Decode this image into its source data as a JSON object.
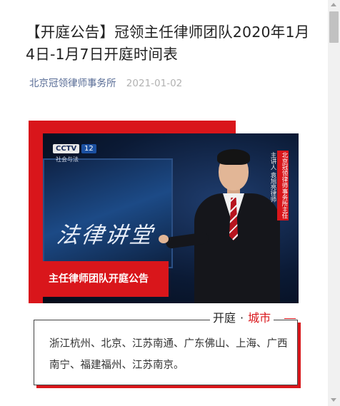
{
  "article": {
    "title": "【开庭公告】冠领主任律师团队2020年1月4日-1月7日开庭时间表",
    "author": "北京冠领律师事务所",
    "date": "2021-01-02"
  },
  "cover": {
    "tv_logo": "CCTV",
    "tv_channel_number": "12",
    "tv_channel_name": "社会与法",
    "program_title": "法律讲堂",
    "presenter_role": "主讲人 袁旭亮律师",
    "presenter_org": "北京冠领律师事务所主任",
    "banner_text": "主任律师团队开庭公告"
  },
  "info": {
    "heading_prefix": "开庭",
    "heading_dot": "·",
    "heading_suffix": "城市",
    "cities_text": "浙江杭州、北京、江苏南通、广东佛山、上海、广西南宁、福建福州、江苏南京。"
  },
  "colors": {
    "accent": "#d9161b",
    "link": "#576b95",
    "date": "#b2b2b2"
  }
}
